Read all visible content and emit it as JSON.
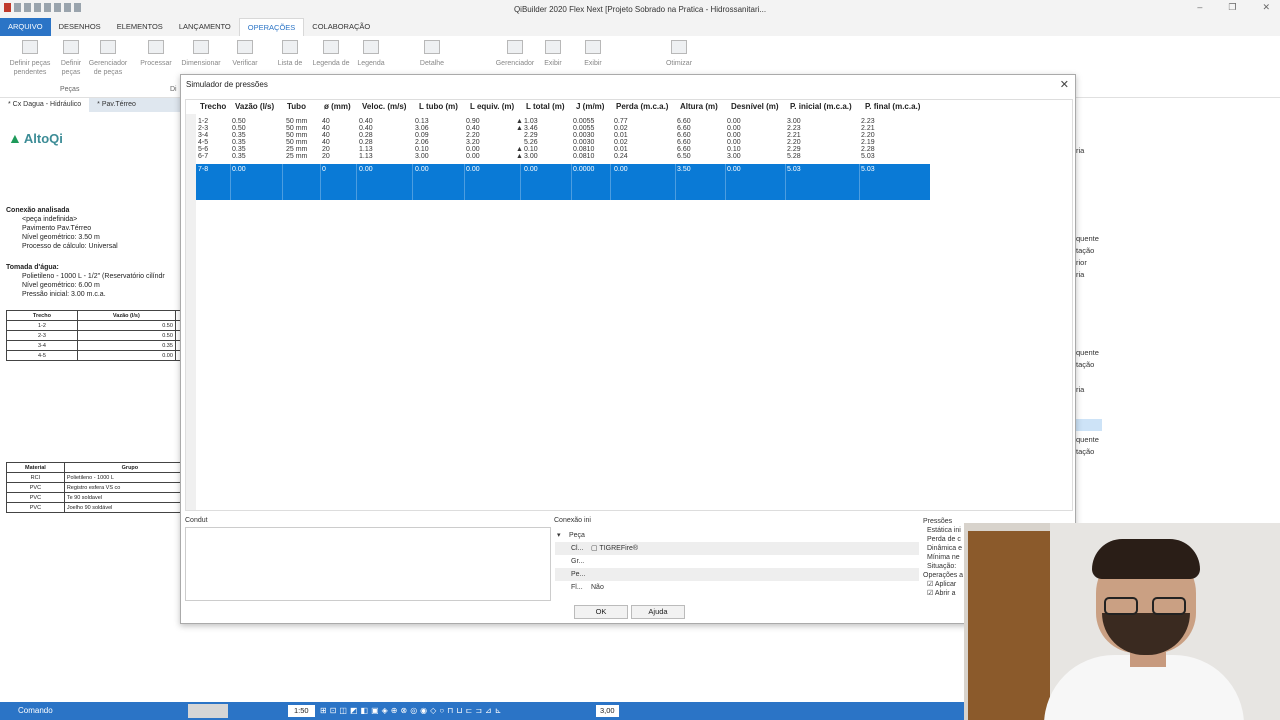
{
  "window": {
    "title": "QiBuilder 2020 Flex Next [Projeto Sobrado na Pratica - Hidrossanitari..."
  },
  "menu": [
    "ARQUIVO",
    "DESENHOS",
    "ELEMENTOS",
    "LANÇAMENTO",
    "OPERAÇÕES",
    "COLABORAÇÃO"
  ],
  "ribbon": {
    "buttons": [
      {
        "l1": "Definir peças",
        "l2": "pendentes"
      },
      {
        "l1": "Definir",
        "l2": "peças"
      },
      {
        "l1": "Gerenciador",
        "l2": "de peças"
      },
      {
        "l1": "Processar",
        "l2": ""
      },
      {
        "l1": "Dimensionar",
        "l2": ""
      },
      {
        "l1": "Verificar",
        "l2": ""
      },
      {
        "l1": "Lista de",
        "l2": ""
      },
      {
        "l1": "Legenda de",
        "l2": ""
      },
      {
        "l1": "Legenda",
        "l2": ""
      },
      {
        "l1": "Detalhe",
        "l2": ""
      },
      {
        "l1": "Gerenciador",
        "l2": ""
      },
      {
        "l1": "Exibir",
        "l2": ""
      },
      {
        "l1": "Exibir",
        "l2": ""
      },
      {
        "l1": "Otimizar",
        "l2": ""
      }
    ],
    "group_pecas": "Peças",
    "group_di": "Di"
  },
  "doctabs": [
    "* Cx Dagua - Hidráulico",
    "* Pav.Térreo"
  ],
  "leftdoc": {
    "logo": "AltoQi",
    "conexao_title": "Conexão analisada",
    "conexao_lines": [
      "<peça indefinida>",
      "Pavimento Pav.Térreo",
      "Nível geométrico: 3.50 m",
      "Processo de cálculo: Universal"
    ],
    "tomada_title": "Tomada d'água:",
    "tomada_lines": [
      "Polietileno - 1000 L - 1/2\" (Reservatório cilíndr",
      "Nível geométrico: 6.00 m",
      "Pressão inicial: 3.00 m.c.a."
    ],
    "table1": {
      "headers": [
        "Trecho",
        "Vazão (l/s)",
        "I"
      ],
      "rows": [
        [
          "1-2",
          "0.50"
        ],
        [
          "2-3",
          "0.50"
        ],
        [
          "3-4",
          "0.35"
        ],
        [
          "4-5",
          "0.00"
        ]
      ]
    },
    "table2": {
      "headers": [
        "Material",
        "Grupo"
      ],
      "rows": [
        [
          "RCI",
          "Polietileno - 1000 L"
        ],
        [
          "PVC",
          "Registro esfera VS co"
        ],
        [
          "PVC",
          "Te 90 soldavel"
        ],
        [
          "PVC",
          "Joelho 90 soldável"
        ]
      ]
    }
  },
  "dialog": {
    "title": "Simulador de pressões",
    "columns": [
      "Trecho",
      "Vazão (l/s)",
      "Tubo",
      "ø (mm)",
      "Veloc. (m/s)",
      "L tubo (m)",
      "L equiv. (m)",
      "L total (m)",
      "J (m/m)",
      "Perda (m.c.a.)",
      "Altura (m)",
      "Desnível (m)",
      "P. inicial (m.c.a.)",
      "P. final (m.c.a.)"
    ],
    "rows": [
      [
        "1-2",
        "0.50",
        "50 mm",
        "40",
        "0.40",
        "0.13",
        "0.90",
        "1.03",
        "0.0055",
        "0.77",
        "6.60",
        "0.00",
        "3.00",
        "2.23"
      ],
      [
        "2-3",
        "0.50",
        "50 mm",
        "40",
        "0.40",
        "3.06",
        "0.40",
        "3.46",
        "0.0055",
        "0.02",
        "6.60",
        "0.00",
        "2.23",
        "2.21"
      ],
      [
        "3-4",
        "0.35",
        "50 mm",
        "40",
        "0.28",
        "0.09",
        "2.20",
        "2.29",
        "0.0030",
        "0.01",
        "6.60",
        "0.00",
        "2.21",
        "2.20"
      ],
      [
        "4-5",
        "0.35",
        "50 mm",
        "40",
        "0.28",
        "2.06",
        "3.20",
        "5.26",
        "0.0030",
        "0.02",
        "6.60",
        "0.00",
        "2.20",
        "2.19"
      ],
      [
        "5-6",
        "0.35",
        "25 mm",
        "20",
        "1.13",
        "0.10",
        "0.00",
        "0.10",
        "0.0810",
        "0.01",
        "6.60",
        "0.10",
        "2.29",
        "2.28"
      ],
      [
        "6-7",
        "0.35",
        "25 mm",
        "20",
        "1.13",
        "3.00",
        "0.00",
        "3.00",
        "0.0810",
        "0.24",
        "6.50",
        "3.00",
        "5.28",
        "5.03"
      ]
    ],
    "selected_row": [
      "7-8",
      "0.00",
      "",
      "0",
      "0.00",
      "0.00",
      "0.00",
      "0.00",
      "0.0000",
      "0.00",
      "3.50",
      "0.00",
      "5.03",
      "5.03"
    ],
    "condut_label": "Condut",
    "conexao_ini_label": "Conexão ini",
    "tree": {
      "group": "Peça",
      "rows": [
        {
          "key": "Cl...",
          "val": "▢ TIGREFire®"
        },
        {
          "key": "Gr...",
          "val": ""
        },
        {
          "key": "Pe...",
          "val": ""
        },
        {
          "key": "Fl...",
          "val": "Não"
        }
      ]
    },
    "pressoes": {
      "title": "Pressões",
      "lines": [
        "Estática ini",
        "Perda de c",
        "Dinâmica e",
        "Mínima ne",
        "Situação:"
      ],
      "ops_title": "Operações a",
      "ops": [
        "Aplicar",
        "Abrir a"
      ]
    },
    "ok": "OK",
    "help": "Ajuda"
  },
  "right_panel": [
    "quente",
    "tação",
    "rior",
    "ria",
    "ria",
    "quente",
    "tação",
    "ria",
    "quente",
    "tação"
  ],
  "statusbar": {
    "command": "Comando",
    "scale": "1:50",
    "zoom": "3,00"
  }
}
